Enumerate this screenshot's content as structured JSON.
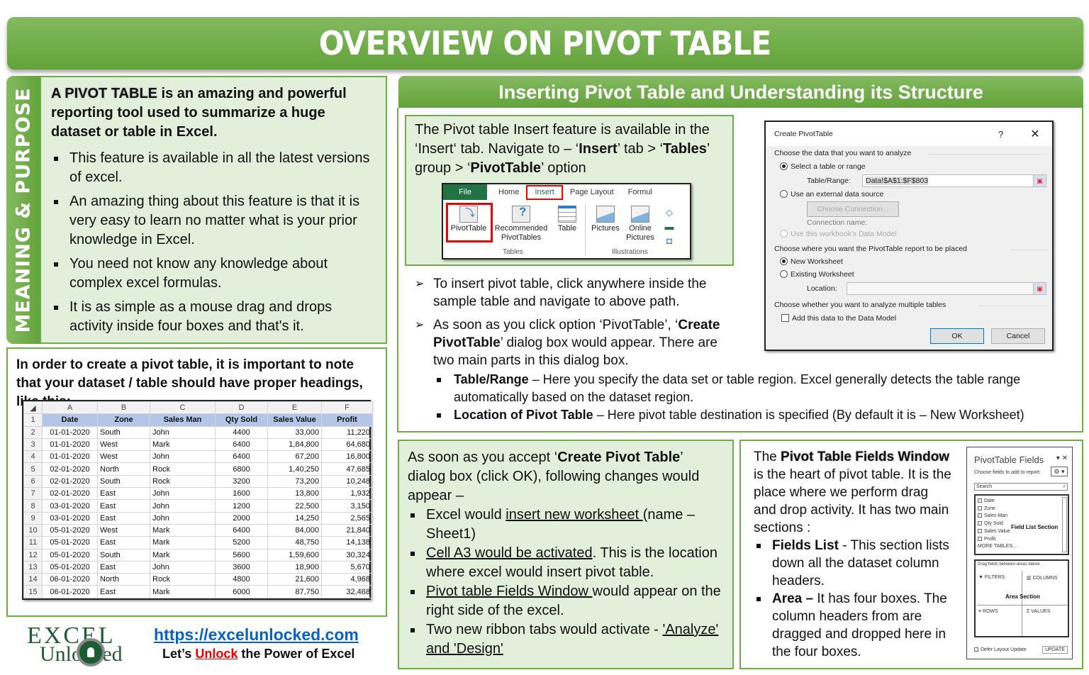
{
  "banner": {
    "title": "OVERVIEW ON PIVOT TABLE"
  },
  "meaning": {
    "tab_label": "MEANING & PURPOSE",
    "lead_bold": "A PIVOT TABLE",
    "lead_rest": " is an amazing and powerful reporting tool used to summarize a huge dataset or table in Excel.",
    "bullets": [
      "This feature is available in all the latest versions of excel.",
      "An amazing thing about this feature is that it is very easy to learn no matter what is your prior knowledge in Excel.",
      "You need not know any knowledge about complex excel formulas.",
      "It is as simple as a mouse drag and drops activity inside four boxes and that's it."
    ]
  },
  "dataset": {
    "lead": "In order to create a pivot table, it is important to note that your dataset / table should have proper headings, like this:",
    "col_letters": [
      "A",
      "B",
      "C",
      "D",
      "E",
      "F"
    ],
    "headers": [
      "Date",
      "Zone",
      "Sales Man",
      "Qty Sold",
      "Sales Value",
      "Profit"
    ],
    "rows": [
      [
        "01-01-2020",
        "South",
        "John",
        "4400",
        "33,000",
        "11,220"
      ],
      [
        "01-01-2020",
        "West",
        "Mark",
        "6400",
        "1,84,800",
        "64,680"
      ],
      [
        "01-01-2020",
        "West",
        "John",
        "6400",
        "67,200",
        "16,800"
      ],
      [
        "02-01-2020",
        "North",
        "Rock",
        "6800",
        "1,40,250",
        "47,685"
      ],
      [
        "02-01-2020",
        "South",
        "Rock",
        "3200",
        "73,200",
        "10,248"
      ],
      [
        "02-01-2020",
        "East",
        "John",
        "1600",
        "13,800",
        "1,932"
      ],
      [
        "03-01-2020",
        "East",
        "John",
        "1200",
        "22,500",
        "3,150"
      ],
      [
        "03-01-2020",
        "East",
        "John",
        "2000",
        "14,250",
        "2,565"
      ],
      [
        "05-01-2020",
        "West",
        "Mark",
        "6400",
        "84,000",
        "21,840"
      ],
      [
        "05-01-2020",
        "East",
        "Mark",
        "5200",
        "48,750",
        "14,138"
      ],
      [
        "05-01-2020",
        "South",
        "Mark",
        "5600",
        "1,59,600",
        "30,324"
      ],
      [
        "05-01-2020",
        "East",
        "John",
        "3600",
        "18,900",
        "5,670"
      ],
      [
        "06-01-2020",
        "North",
        "Rock",
        "4800",
        "21,600",
        "4,968"
      ],
      [
        "06-01-2020",
        "East",
        "Mark",
        "6000",
        "87,750",
        "32,468"
      ]
    ]
  },
  "footer": {
    "logo_line1": "EXCEL",
    "logo_line2": "Unlocked",
    "url": "https://excelunlocked.com",
    "tag_pre": "Let’s ",
    "tag_red": "Unlock",
    "tag_post": " the Power of Excel"
  },
  "inserting": {
    "header": "Inserting Pivot Table and Understanding its Structure",
    "intro": {
      "t1": "The Pivot table Insert feature is available in the ‘Insert‘ tab. Navigate to – ‘",
      "b1": "Insert",
      "t2": "’ tab > ‘",
      "b2": "Tables",
      "t3": "’ group > ‘",
      "b3": "PivotTable",
      "t4": "’ option"
    },
    "ribbon": {
      "tabs": [
        "File",
        "Home",
        "Insert",
        "Page Layout",
        "Formul"
      ],
      "commands": [
        "PivotTable",
        "Recommended PivotTables",
        "Table",
        "Pictures",
        "Online Pictures"
      ],
      "groups": [
        "Tables",
        "Illustrations"
      ]
    },
    "steps": {
      "s1": "To insert pivot table, click anywhere inside the sample table and navigate to above path.",
      "s2_pre": "As soon as you click option ‘PivotTable’, ‘",
      "s2_bold": "Create PivotTable",
      "s2_post": "’ dialog box would appear. There are two main parts in this dialog box."
    },
    "parts": [
      {
        "bold": "Table/Range",
        "text": " – Here you specify the data set or table region. Excel generally detects the table range automatically based on the dataset region."
      },
      {
        "bold": "Location of Pivot Table",
        "text": " – Here pivot table destination is specified (By default it is – New Worksheet)"
      }
    ]
  },
  "dialog": {
    "title": "Create PivotTable",
    "help": "?",
    "close": "✕",
    "section1": "Choose the data that you want to analyze",
    "opt_select": "Select a table or range",
    "range_label": "Table/Range:",
    "range_value": "Data!$A$1:$F$803",
    "opt_external": "Use an external data source",
    "choose_connection": "Choose Connection...",
    "connection_name": "Connection name:",
    "opt_datamodel": "Use this workbook's Data Model",
    "section2": "Choose where you want the PivotTable report to be placed",
    "opt_new": "New Worksheet",
    "opt_existing": "Existing Worksheet",
    "location_label": "Location:",
    "location_value": "",
    "section3": "Choose whether you want to analyze multiple tables",
    "add_datamodel": "Add this data to the Data Model",
    "ok": "OK",
    "cancel": "Cancel"
  },
  "changes": {
    "intro_pre": "As soon as you accept ‘",
    "intro_bold": "Create Pivot Table",
    "intro_post": "’ dialog box (click OK), following changes would appear –",
    "b1_pre": "Excel would ",
    "b1_u": "insert new worksheet ",
    "b1_post": "(name – Sheet1)",
    "b2_u": "Cell A3 would be activated",
    "b2_post": ". This is the location where excel would insert pivot table.",
    "b3_u": "Pivot table Fields Window ",
    "b3_post": "would appear on the right side of the excel.",
    "b4_pre": "Two new ribbon tabs would activate - ",
    "b4_u": "'Analyze' and 'Design'"
  },
  "fields_window": {
    "intro_pre": "The ",
    "intro_bold": "Pivot Table Fields Window",
    "intro_post": " is the heart of pivot table. It is the place where we perform drag and drop activity. It has two main sections :",
    "b1_bold": "Fields List",
    "b1_text": " - This section lists down all the dataset column headers.",
    "b2_bold": "Area –",
    "b2_text": " It has four boxes. The column headers from are dragged and dropped here in the four boxes.",
    "panel": {
      "title": "PivotTable Fields",
      "controls": "▾ ✕",
      "choose": "Choose fields to add to report:",
      "gear": "⚙ ▾",
      "search_placeholder": "Search",
      "fields": [
        "Date",
        "Zone",
        "Sales Man",
        "Qty Sold",
        "Sales Value",
        "Profit"
      ],
      "more_tables": "MORE TABLES...",
      "field_list_label": "Field List Section",
      "drag_hint": "Drag fields between areas below:",
      "areas": [
        "FILTERS",
        "COLUMNS",
        "ROWS",
        "VALUES"
      ],
      "area_label": "Area Section",
      "defer": "Defer Layout Update",
      "update": "UPDATE"
    }
  }
}
